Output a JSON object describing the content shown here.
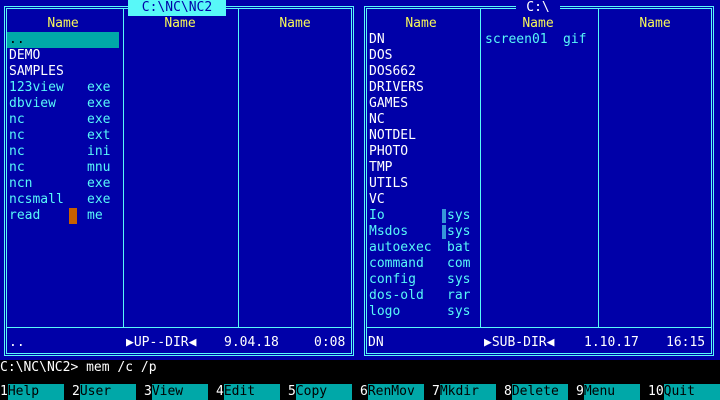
{
  "left_panel": {
    "title": "C:\\NC\\NC2",
    "col_headers": [
      "Name",
      "Name",
      "Name"
    ],
    "files": [
      {
        "name": "..",
        "ext": "",
        "type": "cursor"
      },
      {
        "name": "DEMO",
        "ext": "",
        "type": "dir"
      },
      {
        "name": "SAMPLES",
        "ext": "",
        "type": "dir"
      },
      {
        "name": "123view",
        "ext": "exe",
        "type": "file"
      },
      {
        "name": "dbview",
        "ext": "exe",
        "type": "file"
      },
      {
        "name": "nc",
        "ext": "exe",
        "type": "file"
      },
      {
        "name": "nc",
        "ext": "ext",
        "type": "file"
      },
      {
        "name": "nc",
        "ext": "ini",
        "type": "file"
      },
      {
        "name": "nc",
        "ext": "mnu",
        "type": "file"
      },
      {
        "name": "ncn",
        "ext": "exe",
        "type": "file"
      },
      {
        "name": "ncsmall",
        "ext": "exe",
        "type": "file"
      },
      {
        "name": "read",
        "ext": "me",
        "type": "file"
      }
    ],
    "status_name": "..",
    "status_info": "▶UP--DIR◀",
    "status_date": "9.04.18",
    "status_time": "0:08"
  },
  "right_panel": {
    "title": "C:\\",
    "col_headers": [
      "Name",
      "Name",
      "Name"
    ],
    "files": [
      {
        "name": "DN",
        "ext": "",
        "type": "dir"
      },
      {
        "name": "DOS",
        "ext": "",
        "type": "dir"
      },
      {
        "name": "DOS662",
        "ext": "",
        "type": "dir"
      },
      {
        "name": "DRIVERS",
        "ext": "",
        "type": "dir"
      },
      {
        "name": "GAMES",
        "ext": "",
        "type": "dir"
      },
      {
        "name": "NC",
        "ext": "",
        "type": "dir"
      },
      {
        "name": "NOTDEL",
        "ext": "",
        "type": "dir"
      },
      {
        "name": "PHOTO",
        "ext": "",
        "type": "dir"
      },
      {
        "name": "TMP",
        "ext": "",
        "type": "dir"
      },
      {
        "name": "UTILS",
        "ext": "",
        "type": "dir"
      },
      {
        "name": "VC",
        "ext": "",
        "type": "dir"
      },
      {
        "name": "Io",
        "ext": "sys",
        "type": "sys"
      },
      {
        "name": "Msdos",
        "ext": "sys",
        "type": "sys"
      },
      {
        "name": "autoexec",
        "ext": "bat",
        "type": "file"
      },
      {
        "name": "command",
        "ext": "com",
        "type": "file"
      },
      {
        "name": "config",
        "ext": "sys",
        "type": "file"
      },
      {
        "name": "dos-old",
        "ext": "rar",
        "type": "file"
      },
      {
        "name": "logo",
        "ext": "sys",
        "type": "file"
      }
    ],
    "files_col2": [
      {
        "name": "screen01",
        "ext": "gif",
        "type": "file"
      }
    ],
    "status_name": "DN",
    "status_info": "▶SUB-DIR◀",
    "status_date": "1.10.17",
    "status_time": "16:15"
  },
  "command_line": "C:\\NC\\NC2> mem /c /p",
  "keybar": [
    {
      "num": "1",
      "label": "Help"
    },
    {
      "num": "2",
      "label": "User"
    },
    {
      "num": "3",
      "label": "View"
    },
    {
      "num": "4",
      "label": "Edit"
    },
    {
      "num": "5",
      "label": "Copy"
    },
    {
      "num": "6",
      "label": "RenMov"
    },
    {
      "num": "7",
      "label": "Mkdir"
    },
    {
      "num": "8",
      "label": "Delete"
    },
    {
      "num": "9",
      "label": "Menu"
    },
    {
      "num": "10",
      "label": "Quit"
    }
  ],
  "colors": {
    "panel_bg": "#0000a8",
    "frame": "#58f8f8",
    "header": "#f8f858",
    "cursor_bar": "#00a8a8",
    "text_cursor": "#c86000"
  }
}
